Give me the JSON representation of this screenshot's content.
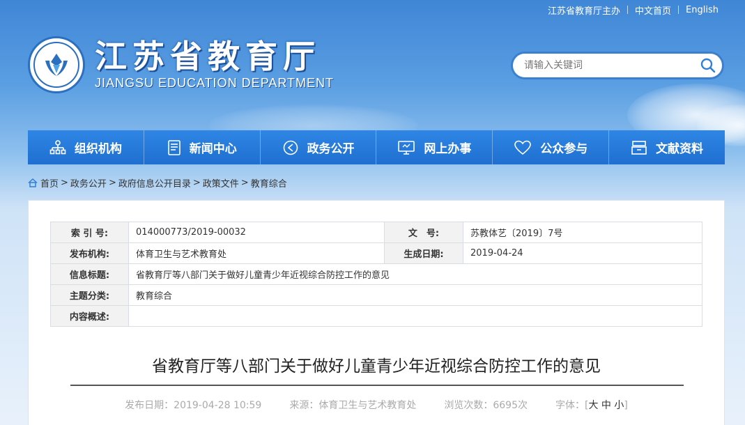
{
  "top_links": {
    "sponsor": "江苏省教育厅主办",
    "home": "中文首页",
    "english": "English"
  },
  "logo": {
    "cn_name": "江苏省教育厅",
    "en_name": "JIANGSU EDUCATION DEPARTMENT"
  },
  "search": {
    "placeholder": "请输入关键词",
    "icon": "search-icon"
  },
  "nav": [
    {
      "label": "组织机构",
      "icon": "org-chart-icon"
    },
    {
      "label": "新闻中心",
      "icon": "document-icon"
    },
    {
      "label": "政务公开",
      "icon": "send-icon"
    },
    {
      "label": "网上办事",
      "icon": "monitor-icon"
    },
    {
      "label": "公众参与",
      "icon": "heart-icon"
    },
    {
      "label": "文献资料",
      "icon": "archive-icon"
    }
  ],
  "breadcrumb": [
    "首页",
    "政务公开",
    "政府信息公开目录",
    "政策文件",
    "教育综合"
  ],
  "meta": {
    "index_label": "索 引 号:",
    "index_value": "014000773/2019-00032",
    "doc_no_label": "文　号:",
    "doc_no_value": "苏教体艺〔2019〕7号",
    "publisher_label": "发布机构:",
    "publisher_value": "体育卫生与艺术教育处",
    "date_label": "生成日期:",
    "date_value": "2019-04-24",
    "info_title_label": "信息标题:",
    "info_title_value": "省教育厅等八部门关于做好儿童青少年近视综合防控工作的意见",
    "category_label": "主题分类:",
    "category_value": "教育综合",
    "summary_label": "内容概述:",
    "summary_value": ""
  },
  "article": {
    "title": "省教育厅等八部门关于做好儿童青少年近视综合防控工作的意见",
    "publish_date": "发布日期：2019-04-28 10:59",
    "source": "来源：体育卫生与艺术教育处",
    "views": "浏览次数：6695次",
    "font_label": "字体：",
    "font_large": "大",
    "font_medium": "中",
    "font_small": "小"
  }
}
